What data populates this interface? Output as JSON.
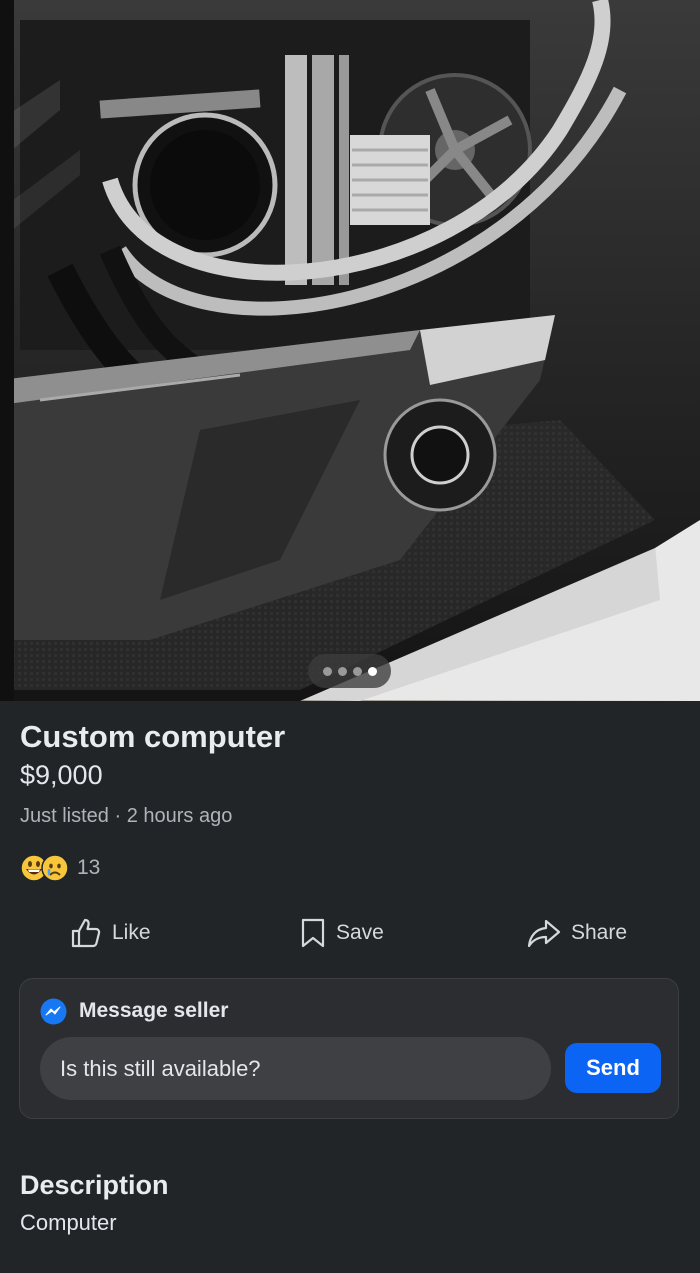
{
  "listing": {
    "title": "Custom computer",
    "price": "$9,000",
    "meta": "Just listed · 2 hours ago",
    "reactions": {
      "icons": [
        "grinning-face-emoji",
        "sad-face-emoji"
      ],
      "count": "13"
    }
  },
  "photo": {
    "description_icon": "pc-case-photo",
    "image_index": 4,
    "image_count": 4
  },
  "actions": {
    "like_label": "Like",
    "save_label": "Save",
    "share_label": "Share"
  },
  "message": {
    "heading": "Message seller",
    "input_value": "Is this still available?",
    "send_label": "Send"
  },
  "description": {
    "heading": "Description",
    "text": "Computer"
  },
  "colors": {
    "background": "#212528",
    "accent": "#0b64f4",
    "card": "#2b2d30"
  }
}
